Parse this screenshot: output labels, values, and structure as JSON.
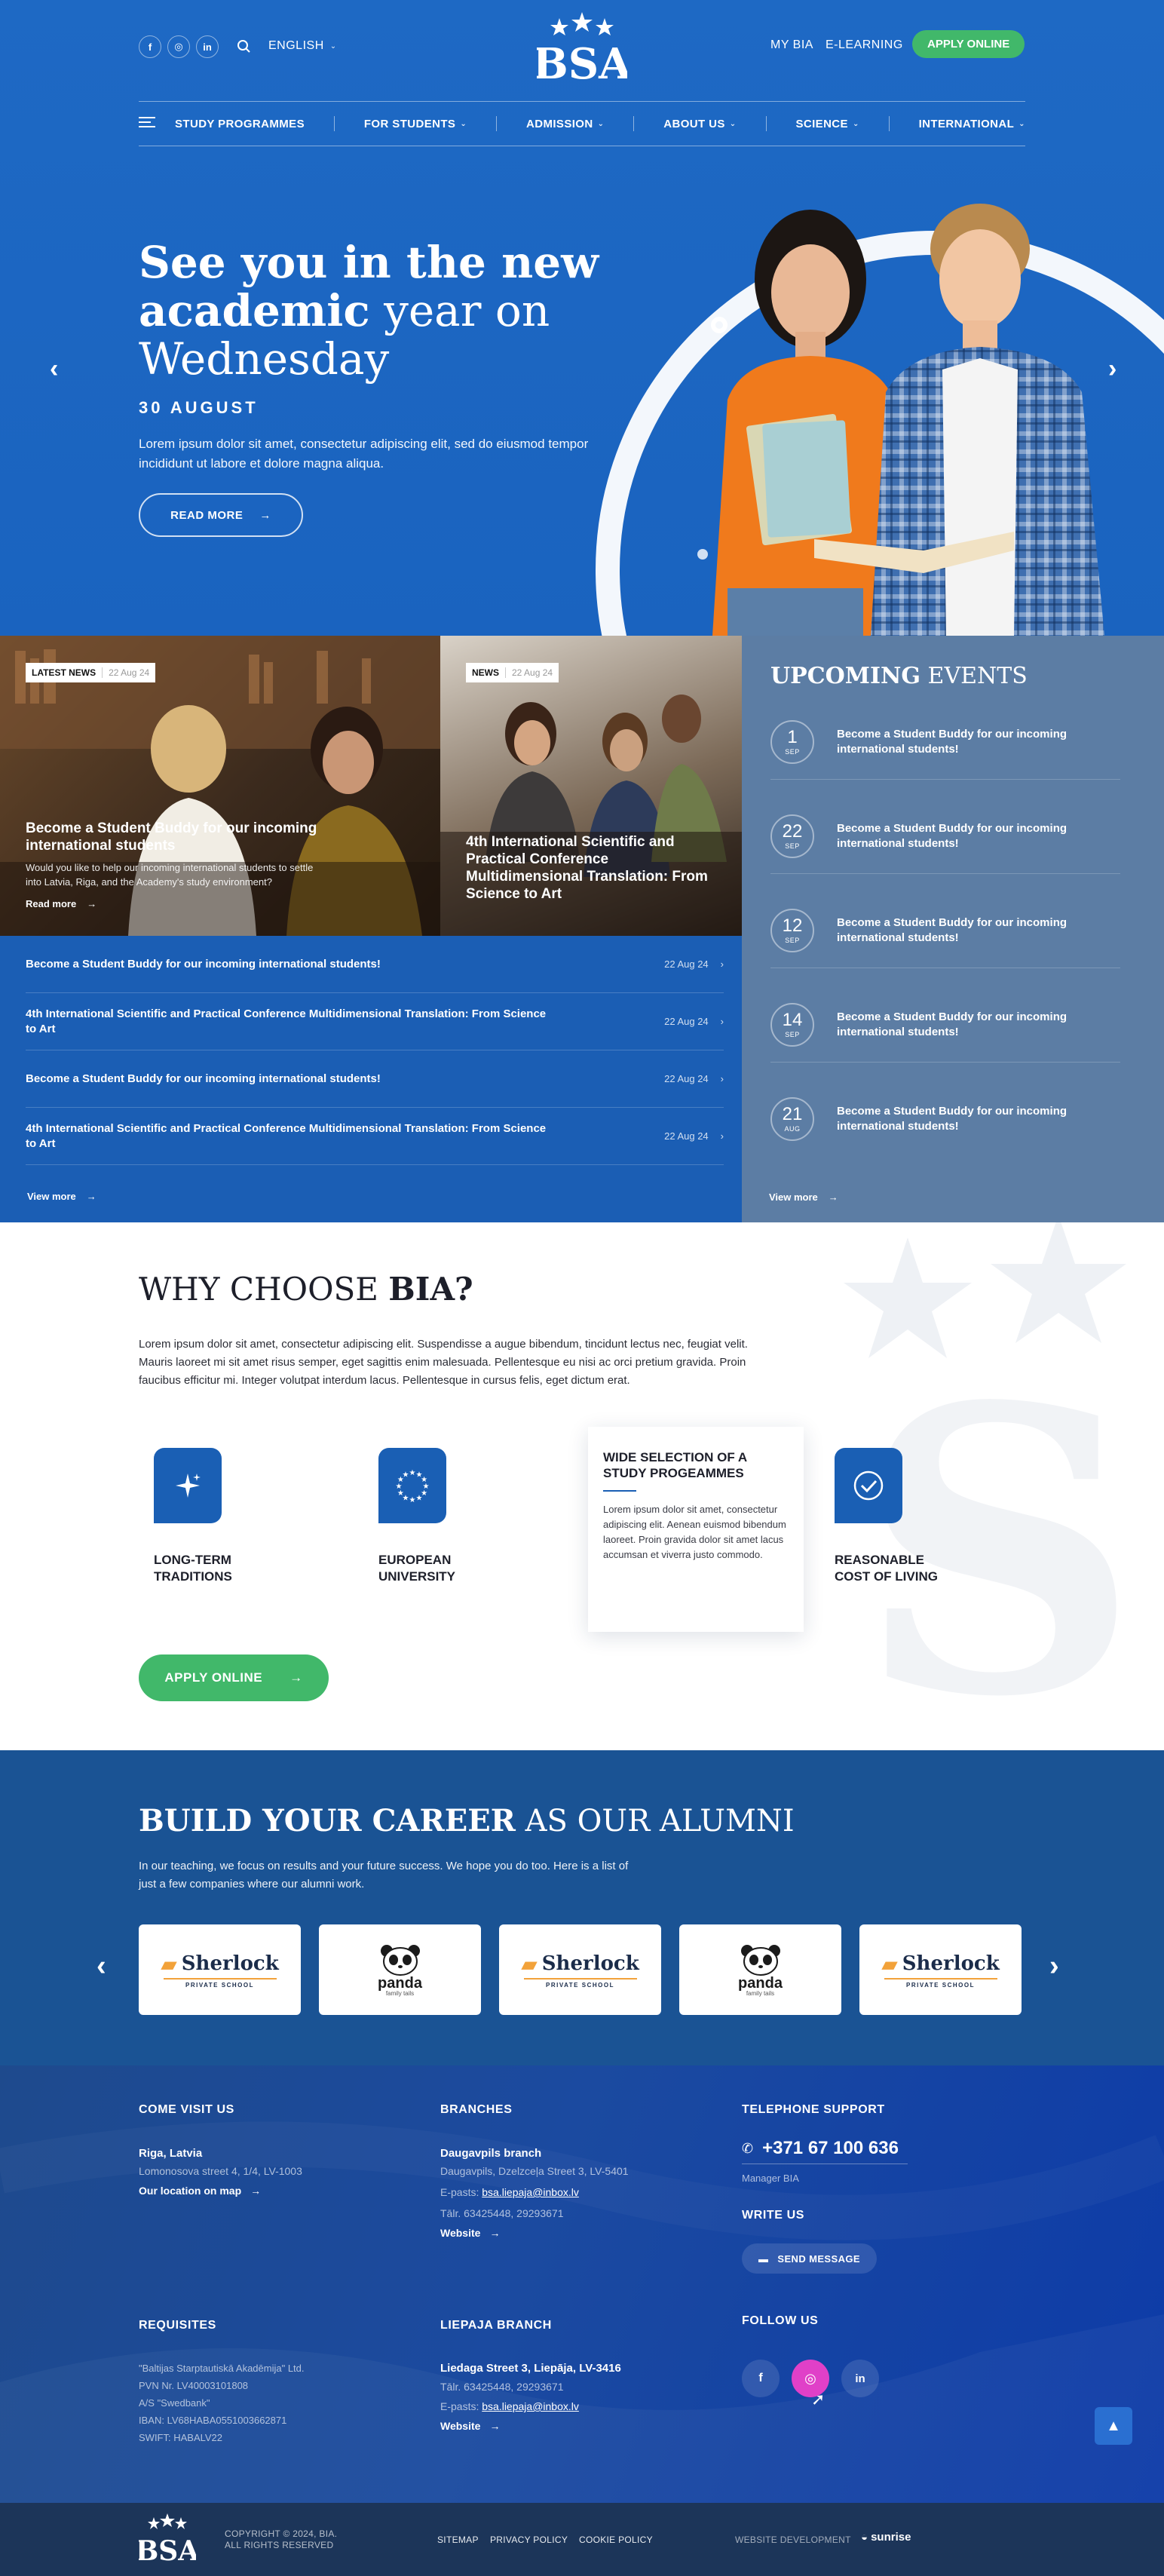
{
  "header": {
    "language": "ENGLISH",
    "my_bia": "MY BIA",
    "e_learning": "E-LEARNING",
    "apply_online": "APPLY ONLINE",
    "logo_text": "BSA",
    "social": [
      "f",
      "◎",
      "in"
    ]
  },
  "menu": [
    "STUDY PROGRAMMES",
    "FOR STUDENTS",
    "ADMISSION",
    "ABOUT US",
    "SCIENCE",
    "INTERNATIONAL"
  ],
  "hero": {
    "title_bold_1": "See you in the new",
    "title_bold_2": "academic",
    "title_light_2": " year on",
    "title_light_3": "Wednesday",
    "date": "30 AUGUST",
    "text": "Lorem ipsum dolor sit amet, consectetur adipiscing elit, sed do eiusmod tempor incididunt ut labore et dolore magna aliqua.",
    "button": "READ MORE"
  },
  "news_cards": [
    {
      "tag": "LATEST NEWS",
      "date": "22 Aug 24",
      "title": "Become a Student Buddy for our incoming international students",
      "text": "Would you like to help our incoming international students to settle into Latvia, Riga, and the Academy's study environment?",
      "link": "Read more"
    },
    {
      "tag": "NEWS",
      "date": "22 Aug 24",
      "title": "4th International Scientific and Practical Conference Multidimensional Translation: From Science to Art"
    }
  ],
  "news_list": [
    {
      "title": "Become a Student Buddy for our incoming international students!",
      "date": "22 Aug 24"
    },
    {
      "title": "4th International Scientific and Practical Conference Multidimensional Translation: From Science to Art",
      "date": "22 Aug 24"
    },
    {
      "title": "Become a Student Buddy for our incoming international students!",
      "date": "22 Aug 24"
    },
    {
      "title": "4th International Scientific and Practical Conference Multidimensional Translation: From Science to Art",
      "date": "22 Aug 24"
    }
  ],
  "news_view_more": "View more",
  "events": {
    "title_bold": "UPCOMING",
    "title_light": " EVENTS",
    "items": [
      {
        "day": "1",
        "month": "SEP",
        "title": "Become a Student Buddy for our incoming international students!"
      },
      {
        "day": "22",
        "month": "SEP",
        "title": "Become a Student Buddy for our incoming international students!"
      },
      {
        "day": "12",
        "month": "SEP",
        "title": "Become a Student Buddy for our incoming international students!"
      },
      {
        "day": "14",
        "month": "SEP",
        "title": "Become a Student Buddy for our incoming international students!"
      },
      {
        "day": "21",
        "month": "AUG",
        "title": "Become a Student Buddy for our incoming international students!"
      }
    ],
    "view_more": "View more"
  },
  "why": {
    "title_light": "WHY CHOOSE ",
    "title_bold": "BIA?",
    "text": "Lorem ipsum dolor sit amet, consectetur adipiscing elit. Suspendisse a augue bibendum, tincidunt lectus nec, feugiat velit. Mauris laoreet mi sit amet risus semper, eget sagittis enim malesuada. Pellentesque eu nisi ac orci pretium gravida. Proin faucibus efficitur mi. Integer volutpat interdum lacus. Pellentesque in cursus felis, eget dictum erat.",
    "features": [
      {
        "icon": "sparkle-icon",
        "label1": "LONG-TERM",
        "label2": "TRADITIONS"
      },
      {
        "icon": "eu-stars-icon",
        "label1": "EUROPEAN",
        "label2": "UNIVERSITY"
      },
      {
        "icon": "checkmark-icon",
        "label1": "REASONABLE",
        "label2": "COST OF LIVING"
      }
    ],
    "card": {
      "title": "WIDE SELECTION OF A STUDY PROGEAMMES",
      "text": "Lorem ipsum dolor sit amet, consectetur adipiscing elit. Aenean euismod bibendum laoreet. Proin gravida dolor sit amet lacus accumsan et viverra justo commodo."
    },
    "button": "APPLY ONLINE"
  },
  "career": {
    "title_bold": "BUILD YOUR CAREER",
    "title_light": " AS OUR ALUMNI",
    "text": "In our teaching, we focus on results and your future success. We hope you do too. Here is a list of just a few companies where our alumni work.",
    "logos": [
      {
        "name": "Sherlock",
        "sub": "PRIVATE SCHOOL",
        "kind": "sherlock"
      },
      {
        "name": "panda",
        "sub": "family tails",
        "kind": "panda"
      },
      {
        "name": "Sherlock",
        "sub": "PRIVATE SCHOOL",
        "kind": "sherlock"
      },
      {
        "name": "panda",
        "sub": "family tails",
        "kind": "panda"
      },
      {
        "name": "Sherlock",
        "sub": "PRIVATE SCHOOL",
        "kind": "sherlock"
      }
    ]
  },
  "footer": {
    "visit": {
      "heading": "COME VISIT US",
      "city": "Riga, Latvia",
      "address": "Lomonosova street 4, 1/4, LV-1003",
      "map": "Our location on map"
    },
    "branches": {
      "heading": "BRANCHES",
      "name": "Daugavpils branch",
      "address": "Daugavpils, Dzelzceļa Street 3,  LV-5401",
      "email_label": "E-pasts: ",
      "email": "bsa.liepaja@inbox.lv",
      "phone": "Tālr. 63425448, 29293671",
      "website": "Website"
    },
    "phone": {
      "heading": "TELEPHONE SUPPORT",
      "number": "+371 67 100 636",
      "manager": "Manager BIA"
    },
    "write": {
      "heading": "WRITE US",
      "button": "SEND MESSAGE"
    },
    "requisites": {
      "heading": "REQUISITES",
      "lines": [
        "\"Baltijas Starptautiskā Akadēmija\" Ltd.",
        "PVN Nr. LV40003101808",
        "A/S \"Swedbank\"",
        "IBAN: LV68HABA0551003662871",
        "SWIFT: HABALV22"
      ]
    },
    "liepaja": {
      "heading": "LIEPAJA BRANCH",
      "address": "Liedaga Street 3, Liepāja, LV-3416",
      "phone": "Tālr. 63425448, 29293671",
      "email_label": "E-pasts: ",
      "email": "bsa.liepaja@inbox.lv",
      "website": "Website"
    },
    "follow": {
      "heading": "FOLLOW US",
      "icons": [
        "f",
        "◎",
        "in"
      ]
    }
  },
  "bottom": {
    "copyright1": "COPYRIGHT © 2024, BIA.",
    "copyright2": "ALL RIGHTS RESERVED",
    "links": [
      "SITEMAP",
      "PRIVACY POLICY",
      "COOKIE POLICY"
    ],
    "dev_label": "WEBSITE DEVELOPMENT",
    "dev_name": "sunrise"
  },
  "colors": {
    "primary": "#1e69c4",
    "green": "#41b86a",
    "events_bg": "#5c7da4",
    "footer_dark": "#1c3559",
    "instagram": "#e040c8"
  }
}
